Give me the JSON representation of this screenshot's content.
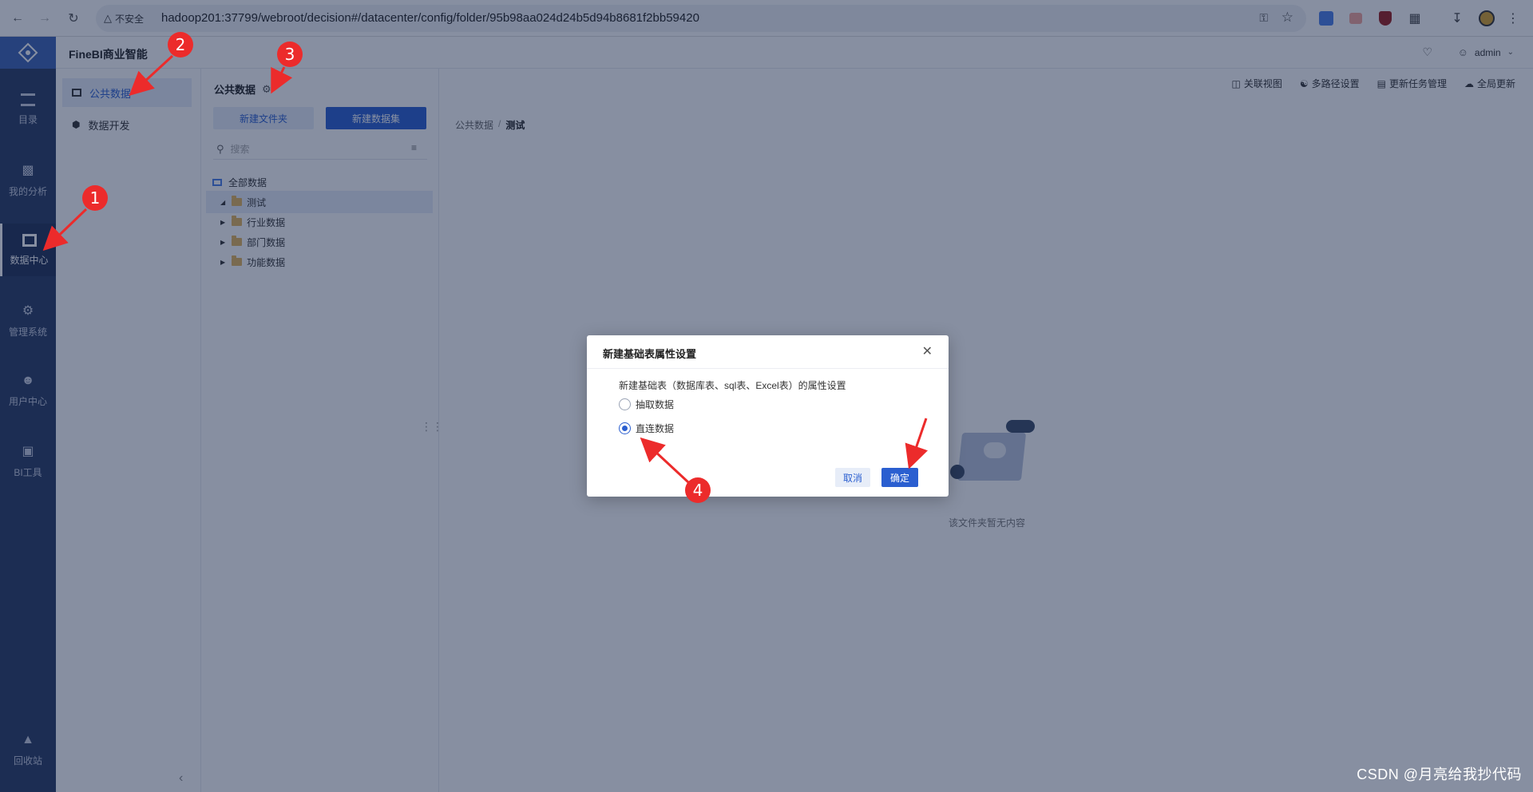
{
  "browser": {
    "security_label": "不安全",
    "url": "hadoop201:37799/webroot/decision#/datacenter/config/folder/95b98aa024d24b5d94b8681f2bb59420"
  },
  "app": {
    "title": "FineBI商业智能",
    "user": "admin"
  },
  "rail": {
    "items": [
      {
        "label": "目录",
        "icon": "catalog-icon"
      },
      {
        "label": "我的分析",
        "icon": "bar-chart-icon"
      },
      {
        "label": "数据中心",
        "icon": "database-icon",
        "active": true
      },
      {
        "label": "管理系统",
        "icon": "gear-icon"
      },
      {
        "label": "用户中心",
        "icon": "user-icon"
      },
      {
        "label": "BI工具",
        "icon": "toolbox-icon"
      },
      {
        "label": "回收站",
        "icon": "recycle-icon"
      }
    ]
  },
  "secnav": {
    "items": [
      {
        "label": "公共数据",
        "active": true
      },
      {
        "label": "数据开发"
      }
    ]
  },
  "tree": {
    "title": "公共数据",
    "new_folder": "新建文件夹",
    "new_dataset": "新建数据集",
    "search_placeholder": "搜索",
    "nodes": [
      {
        "label": "全部数据"
      },
      {
        "label": "测试",
        "selected": true,
        "expanded": true
      },
      {
        "label": "行业数据"
      },
      {
        "label": "部门数据"
      },
      {
        "label": "功能数据"
      }
    ]
  },
  "toolbar": [
    "关联视图",
    "多路径设置",
    "更新任务管理",
    "全局更新"
  ],
  "breadcrumb": [
    "公共数据",
    "测试"
  ],
  "content": {
    "empty_text": "该文件夹暂无内容"
  },
  "dialog": {
    "title": "新建基础表属性设置",
    "description": "新建基础表（数据库表、sql表、Excel表）的属性设置",
    "options": [
      "抽取数据",
      "直连数据"
    ],
    "selected_option": "直连数据",
    "cancel": "取消",
    "confirm": "确定"
  },
  "annotations": [
    "1",
    "2",
    "3",
    "4"
  ],
  "watermark": "CSDN @月亮给我抄代码",
  "colors": {
    "primary": "#2b5fd0",
    "rail": "#283a63",
    "annotation": "#ec2b2b"
  }
}
